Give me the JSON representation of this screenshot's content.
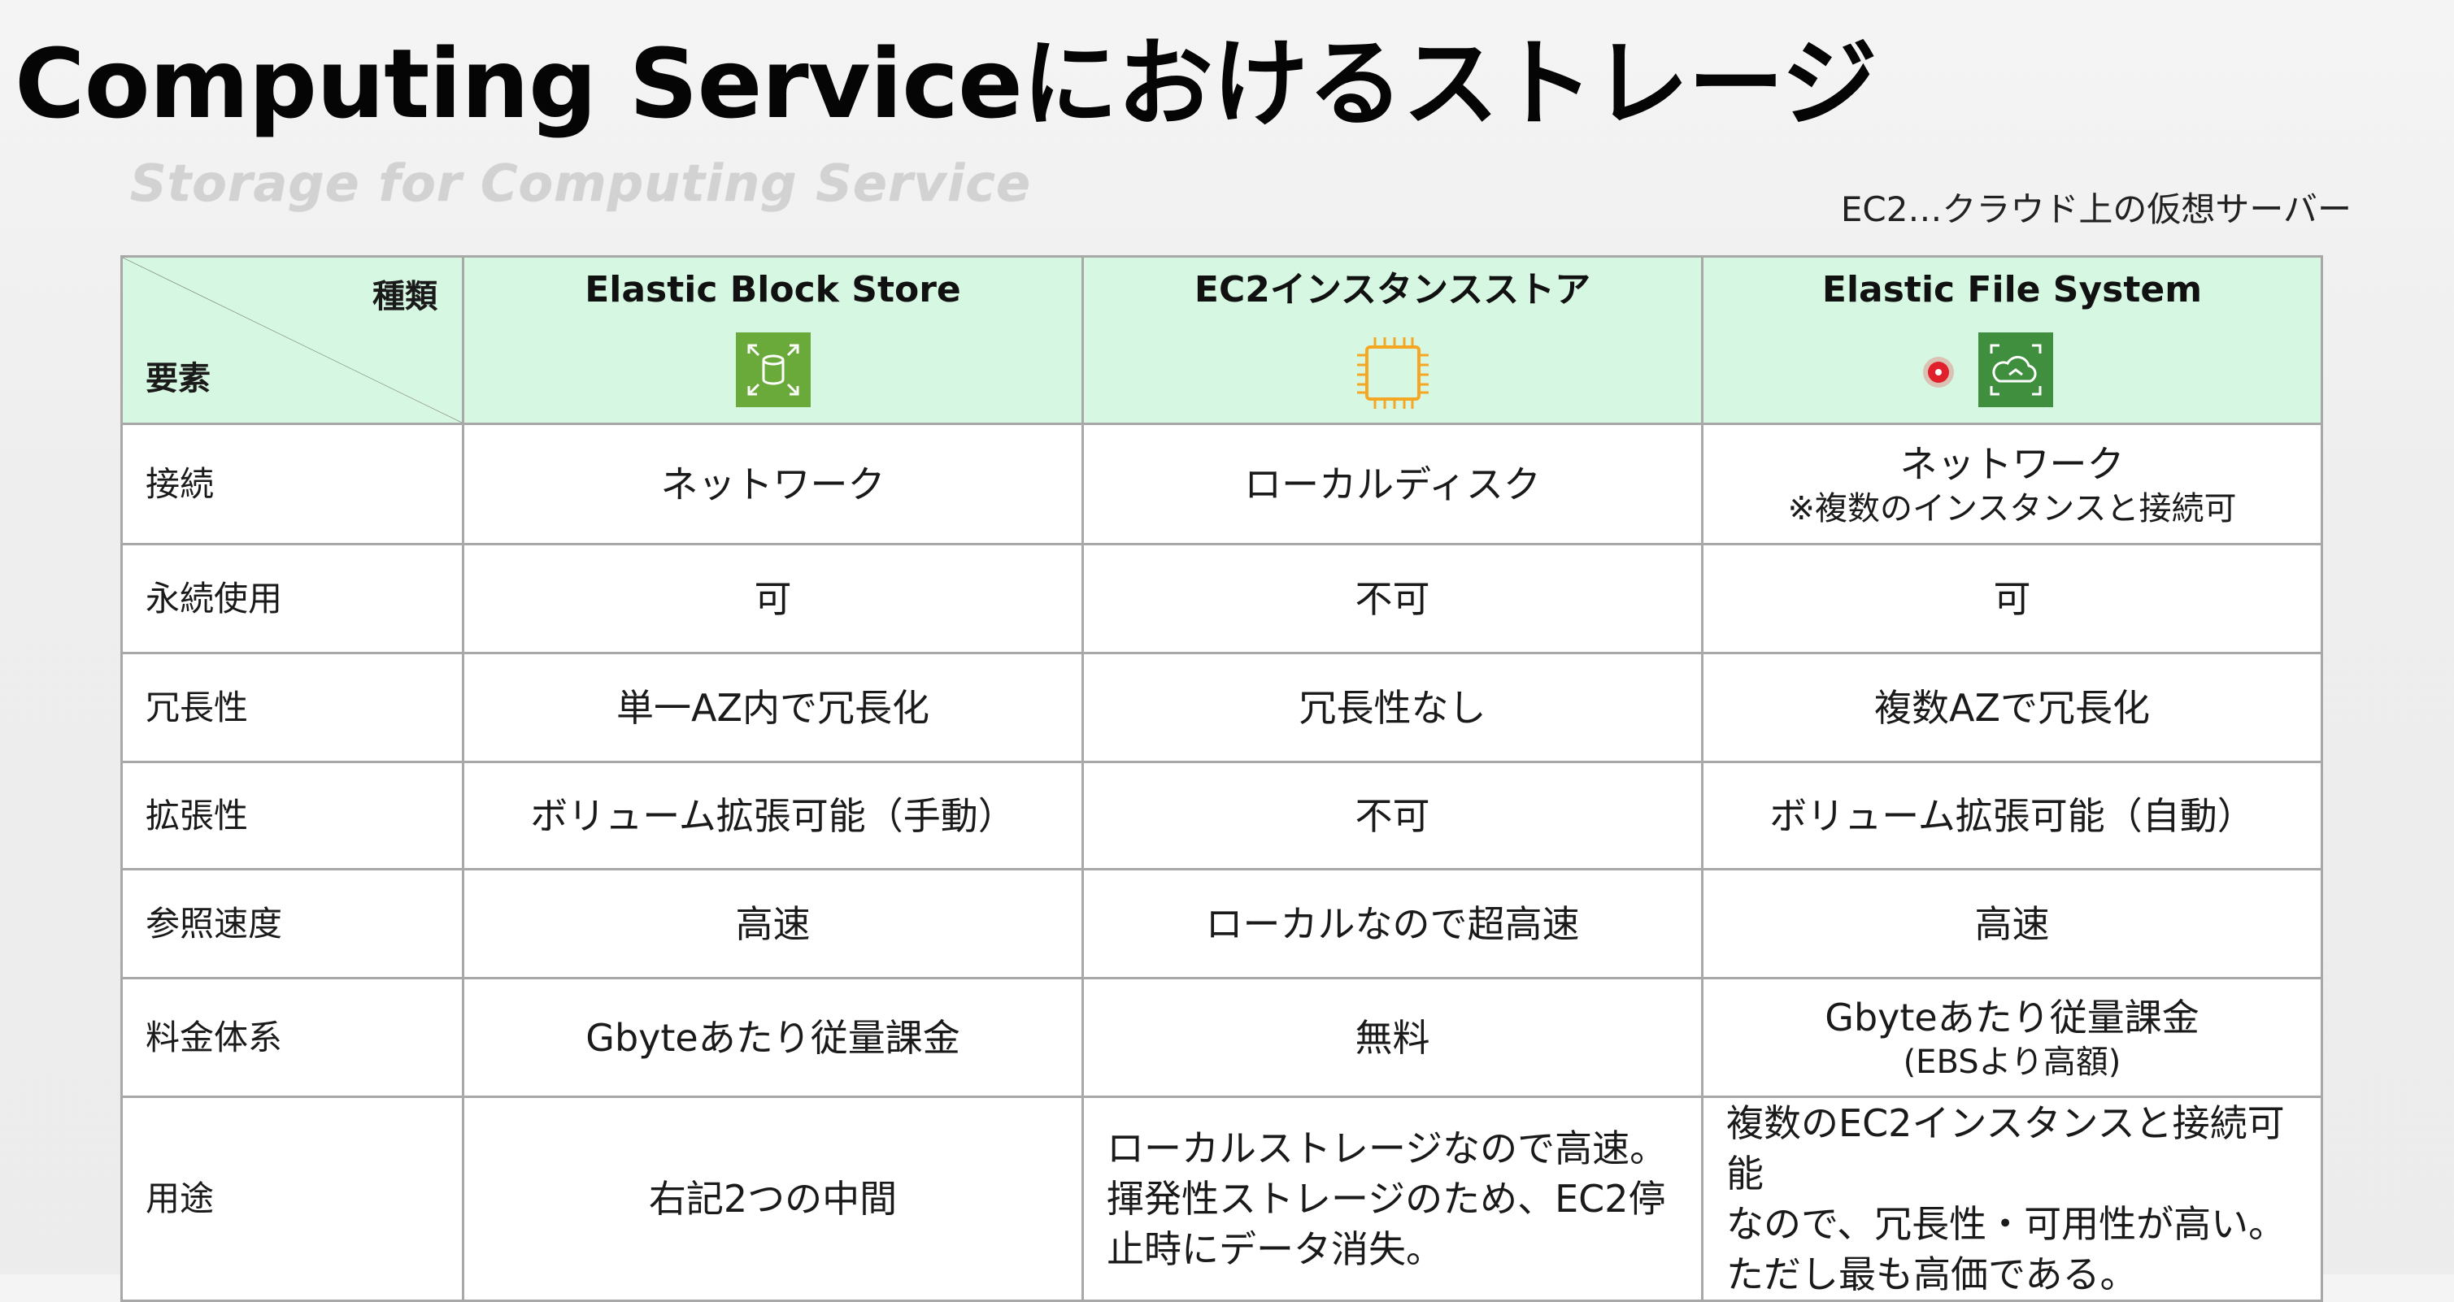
{
  "title": "Computing Serviceにおけるストレージ",
  "subtitle": "Storage for Computing Service",
  "note": "EC2…クラウド上の仮想サーバー",
  "table": {
    "corner_top": "種類",
    "corner_bottom": "要素",
    "columns": [
      {
        "name": "Elastic Block Store",
        "icon": "ebs-volume-icon",
        "icon_color": "#6aaa3a"
      },
      {
        "name": "EC2インスタンスストア",
        "icon": "ec2-chip-icon",
        "icon_color": "#f5a623"
      },
      {
        "name": "Elastic File System",
        "icon": "efs-cloud-icon",
        "icon_color": "#3f8f3f"
      }
    ],
    "rows": [
      {
        "label": "接続",
        "cells": [
          {
            "text": "ネットワーク"
          },
          {
            "text": "ローカルディスク"
          },
          {
            "text": "ネットワーク",
            "sub": "※複数のインスタンスと接続可"
          }
        ]
      },
      {
        "label": "永続使用",
        "cells": [
          {
            "text": "可"
          },
          {
            "text": "不可"
          },
          {
            "text": "可"
          }
        ]
      },
      {
        "label": "冗長性",
        "cells": [
          {
            "text": "単一AZ内で冗長化"
          },
          {
            "text": "冗長性なし"
          },
          {
            "text": "複数AZで冗長化"
          }
        ]
      },
      {
        "label": "拡張性",
        "cells": [
          {
            "text": "ボリューム拡張可能（手動）"
          },
          {
            "text": "不可"
          },
          {
            "text": "ボリューム拡張可能（自動）"
          }
        ]
      },
      {
        "label": "参照速度",
        "cells": [
          {
            "text": "高速"
          },
          {
            "text": "ローカルなので超高速"
          },
          {
            "text": "高速"
          }
        ]
      },
      {
        "label": "料金体系",
        "cells": [
          {
            "text": "Gbyteあたり従量課金"
          },
          {
            "text": "無料"
          },
          {
            "text": "Gbyteあたり従量課金",
            "sub": "(EBSより高額)"
          }
        ]
      },
      {
        "label": "用途",
        "cells": [
          {
            "text": "右記2つの中間"
          },
          {
            "lines": [
              "ローカルストレージなので高速。",
              "揮発性ストレージのため、EC2停",
              "止時にデータ消失。"
            ]
          },
          {
            "lines": [
              "複数のEC2インスタンスと接続可能",
              "なので、冗長性・可用性が高い。",
              "ただし最も高価である。"
            ]
          }
        ]
      }
    ]
  },
  "colors": {
    "header_bg": "#d6f7e1",
    "border": "#a8a8a8",
    "cursor": "#e0202a"
  }
}
